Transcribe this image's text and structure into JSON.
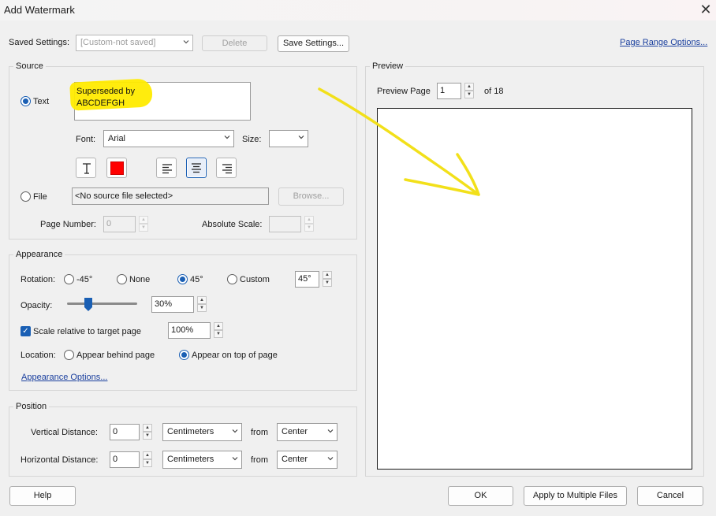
{
  "window": {
    "title": "Add Watermark",
    "close_icon": "close-icon"
  },
  "saved_settings": {
    "label": "Saved Settings:",
    "value": "[Custom-not saved]",
    "delete_label": "Delete",
    "save_label": "Save Settings...",
    "page_range_link": "Page Range Options..."
  },
  "source": {
    "group_label": "Source",
    "text_option": "Text",
    "text_lines": [
      "Superseded by",
      "ABCDEFGH"
    ],
    "font_label": "Font:",
    "font_value": "Arial",
    "size_label": "Size:",
    "size_value": "",
    "text_color": "#ff0000",
    "file_option": "File",
    "file_value": "<No source file selected>",
    "browse_label": "Browse...",
    "page_number_label": "Page Number:",
    "page_number_value": "0",
    "absolute_scale_label": "Absolute Scale:",
    "absolute_scale_value": ""
  },
  "appearance": {
    "group_label": "Appearance",
    "rotation_label": "Rotation:",
    "rotation_options": [
      "-45°",
      "None",
      "45°",
      "Custom"
    ],
    "rotation_selected": "45°",
    "custom_rotation_value": "45°",
    "opacity_label": "Opacity:",
    "opacity_value": "30%",
    "opacity_level": 0.3,
    "scale_label": "Scale relative to target page",
    "scale_value": "100%",
    "location_label": "Location:",
    "location_options": [
      "Appear behind page",
      "Appear on top of page"
    ],
    "location_selected": "Appear on top of page",
    "options_link": "Appearance Options..."
  },
  "position": {
    "group_label": "Position",
    "vertical_label": "Vertical Distance:",
    "vertical_value": "0",
    "vertical_unit": "Centimeters",
    "vertical_from_label": "from",
    "vertical_from": "Center",
    "horizontal_label": "Horizontal Distance:",
    "horizontal_value": "0",
    "horizontal_unit": "Centimeters",
    "horizontal_from_label": "from",
    "horizontal_from": "Center"
  },
  "preview": {
    "group_label": "Preview",
    "page_label": "Preview Page",
    "page_value": "1",
    "of_label": "of 18"
  },
  "footer": {
    "help_label": "Help",
    "ok_label": "OK",
    "apply_multiple_label": "Apply to Multiple Files",
    "cancel_label": "Cancel"
  },
  "colors": {
    "accent": "#1a5fb4",
    "highlight": "#ffeb00",
    "annotation": "#f2e01a"
  }
}
